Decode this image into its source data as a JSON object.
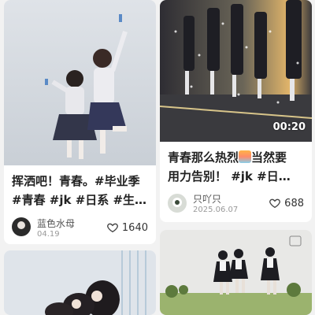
{
  "cards": [
    {
      "title_line1": "挥洒吧！青春。#毕业季",
      "title_line2": "#青春 #jk #日系 #生…",
      "author": "蓝色水母",
      "date": "04.19",
      "likes": "1640",
      "image": "girls-jumping-sky-photo"
    },
    {
      "title_line1": "青春那么热烈",
      "title_emoji": "sunset-emoji",
      "title_line1b": "当然要",
      "title_line2": "用力告别！ #jk #日…",
      "author": "只吖只",
      "date": "2025.06.07",
      "likes": "688",
      "duration": "00:20",
      "image": "students-sunset-video"
    },
    {
      "image": "girls-lying-building-photo"
    },
    {
      "image": "girls-field-photo"
    }
  ],
  "colors": {
    "accent": "#ffffff",
    "text": "#222222",
    "meta": "#999999"
  }
}
